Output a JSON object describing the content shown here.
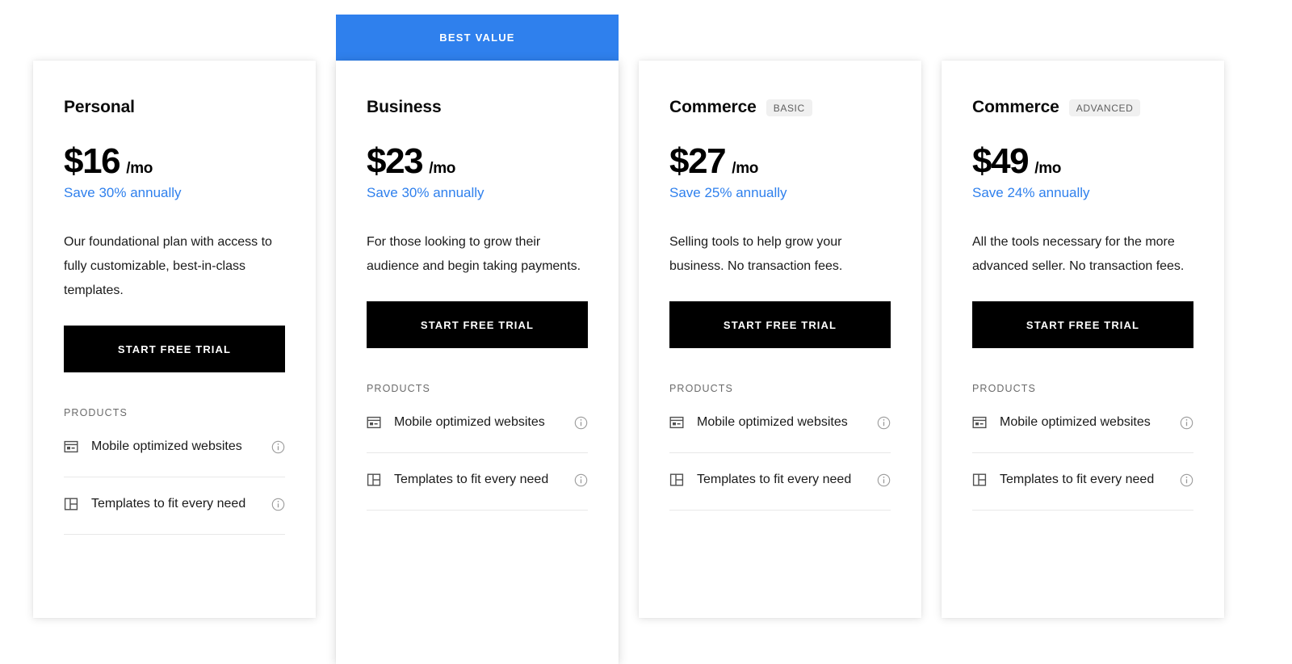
{
  "theme": {
    "accent_blue": "#2f80ed",
    "button_black": "#000000",
    "badge_gray": "#f0f0f0",
    "page_background": "#ffffff"
  },
  "banner": {
    "label": "BEST VALUE"
  },
  "labels": {
    "products_section": "PRODUCTS",
    "cta": "START FREE TRIAL",
    "info_icon": "info-icon"
  },
  "features": [
    {
      "icon": "mobile-optimized-websites-icon",
      "label": "Mobile optimized websites",
      "info": "i"
    },
    {
      "icon": "templates-layout-icon",
      "label": "Templates to fit every need",
      "info": "i"
    }
  ],
  "plans": [
    {
      "name": "Personal",
      "tier": "",
      "featured": false,
      "price": "$16",
      "period": "/mo",
      "save": "Save 30% annually",
      "description": "Our foundational plan with access to fully customizable, best-in-class templates.",
      "cta": "START FREE TRIAL",
      "products_label": "PRODUCTS"
    },
    {
      "name": "Business",
      "tier": "",
      "featured": true,
      "badge": "BEST VALUE",
      "price": "$23",
      "period": "/mo",
      "save": "Save 30% annually",
      "description": "For those looking to grow their audience and begin taking payments.",
      "cta": "START FREE TRIAL",
      "products_label": "PRODUCTS"
    },
    {
      "name": "Commerce",
      "tier": "BASIC",
      "featured": false,
      "price": "$27",
      "period": "/mo",
      "save": "Save 25% annually",
      "description": "Selling tools to help grow your business. No transaction fees.",
      "cta": "START FREE TRIAL",
      "products_label": "PRODUCTS"
    },
    {
      "name": "Commerce",
      "tier": "ADVANCED",
      "featured": false,
      "price": "$49",
      "period": "/mo",
      "save": "Save 24% annually",
      "description": "All the tools necessary for the more advanced seller. No transaction fees.",
      "cta": "START FREE TRIAL",
      "products_label": "PRODUCTS"
    }
  ]
}
